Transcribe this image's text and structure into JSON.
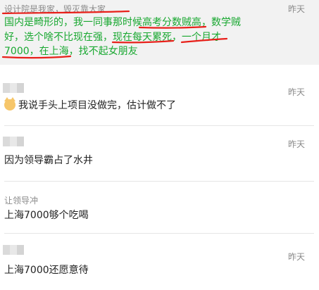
{
  "comments": [
    {
      "author": "设计院是我家，毁灭靠大家",
      "time": "昨天",
      "lines": [
        "国内是畸形的，我一同事那时候高考分数贼高，数学贼",
        "好，选个啥不比现在强，现在每天累死，一个月才",
        "7000，在上海，找不起女朋友"
      ],
      "text_color": "#19a831"
    },
    {
      "time": "昨天",
      "emoji": "cat-face-emoji",
      "text": "我说手头上项目没做完，估计做不了"
    },
    {
      "time": "昨天",
      "text": "因为领导霸占了水井"
    },
    {
      "author": "让领导冲",
      "text": "上海7000够个吃喝"
    },
    {
      "time": "昨天",
      "text": "上海7000还愿意待"
    }
  ],
  "annotation_color": "#e8201a"
}
